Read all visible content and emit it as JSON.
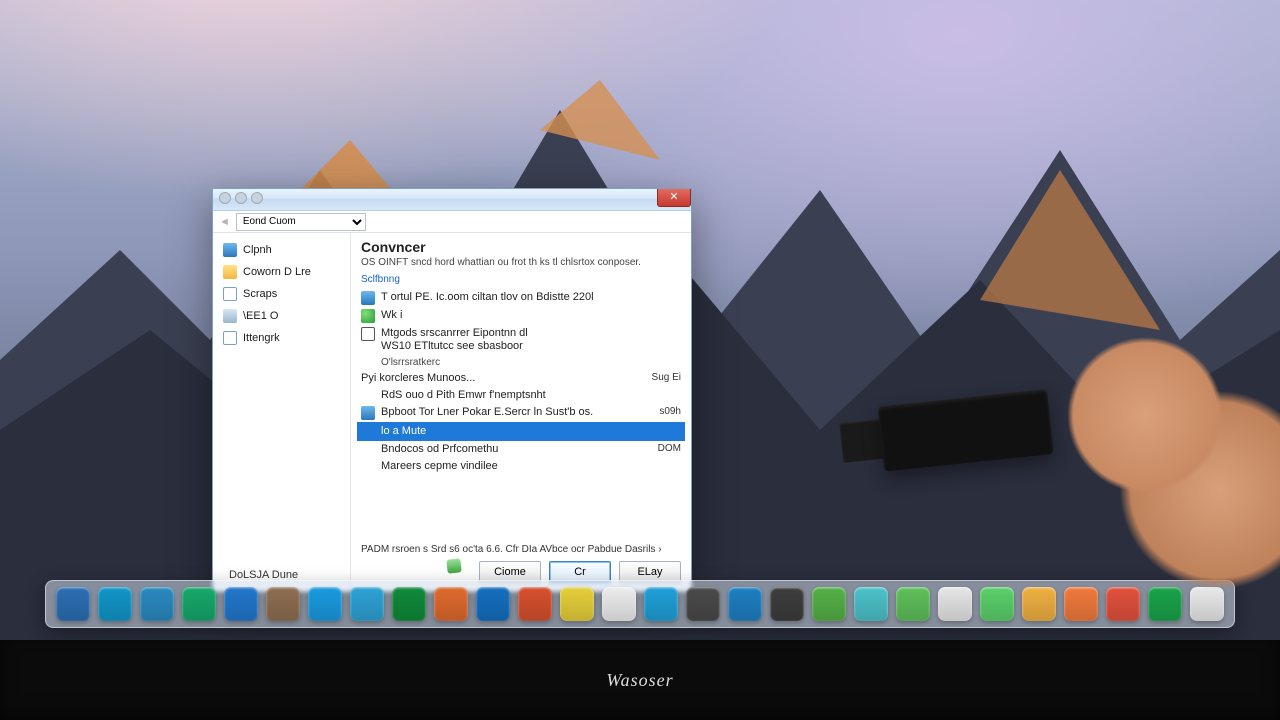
{
  "monitor_brand": "Wasoser",
  "window": {
    "dropdown_value": "Eond Cuom",
    "heading": "Convncer",
    "subheading": "OS OINFT sncd hord whattian ou frot th ks tl chlsrtox conposer.",
    "link_label": "Sclfbnng",
    "check_label": "T ortul PE. Ic.oom ciltan tlov on Bdistte  220l",
    "item_wk": "Wk i",
    "item_box_line1": "Mtgods srscanrrer Eipontnn dl",
    "item_box_line2": "WS10 ETltutcc see sbasboor",
    "subcaption": "O'lsrrsratkerc",
    "net_label": "Pyi korcleres Munoos...",
    "net_size": "Sug Ei",
    "row_a": "RdS ouo d Pith Emwr f'nemptsnht",
    "row_b": "Bpboot  Tor Lner Pokar E.Sercr ln Sust'b os.",
    "row_b_size": "s09h",
    "row_selected": "lo a Mute",
    "row_c": "Bndocos od Prfcomethu",
    "row_c_size": "DOM",
    "row_d": "Mareers cepme vindilee",
    "footer_text": "PADM rsroen s Srd s6 oc'ta 6.6. Cfr DIa AVbce ocr Pabdue Dasrils",
    "buttons": {
      "close": "Ciome",
      "primary": "Cr",
      "secondary": "ELay"
    }
  },
  "sidebar": {
    "items": [
      {
        "icon": "monitor",
        "label": "Clpnh"
      },
      {
        "icon": "folder",
        "label": "Coworn D Lre"
      },
      {
        "icon": "doc",
        "label": "Scraps"
      },
      {
        "icon": "disk",
        "label": "\\EE1 O"
      },
      {
        "icon": "doc",
        "label": "Ittengrk"
      }
    ],
    "bottom_label": "DoLSJA Dune"
  },
  "dock_colors": [
    "#2b6fb3",
    "#1196c9",
    "#2a8ac0",
    "#17a86b",
    "#2277cc",
    "#8e6e52",
    "#1a9be0",
    "#2ea2d6",
    "#0f8a3a",
    "#de6a2e",
    "#146fbf",
    "#d6502e",
    "#e6cf3a",
    "#ededed",
    "#1fa0d8",
    "#4a4a4a",
    "#1e7fc2",
    "#3d3d3d",
    "#55b047",
    "#4cc2c9",
    "#5ec05a",
    "#e6e6e6",
    "#5bd06a",
    "#efb042",
    "#f07a3c",
    "#e2513d",
    "#1aa34a",
    "#e9e9e9"
  ]
}
